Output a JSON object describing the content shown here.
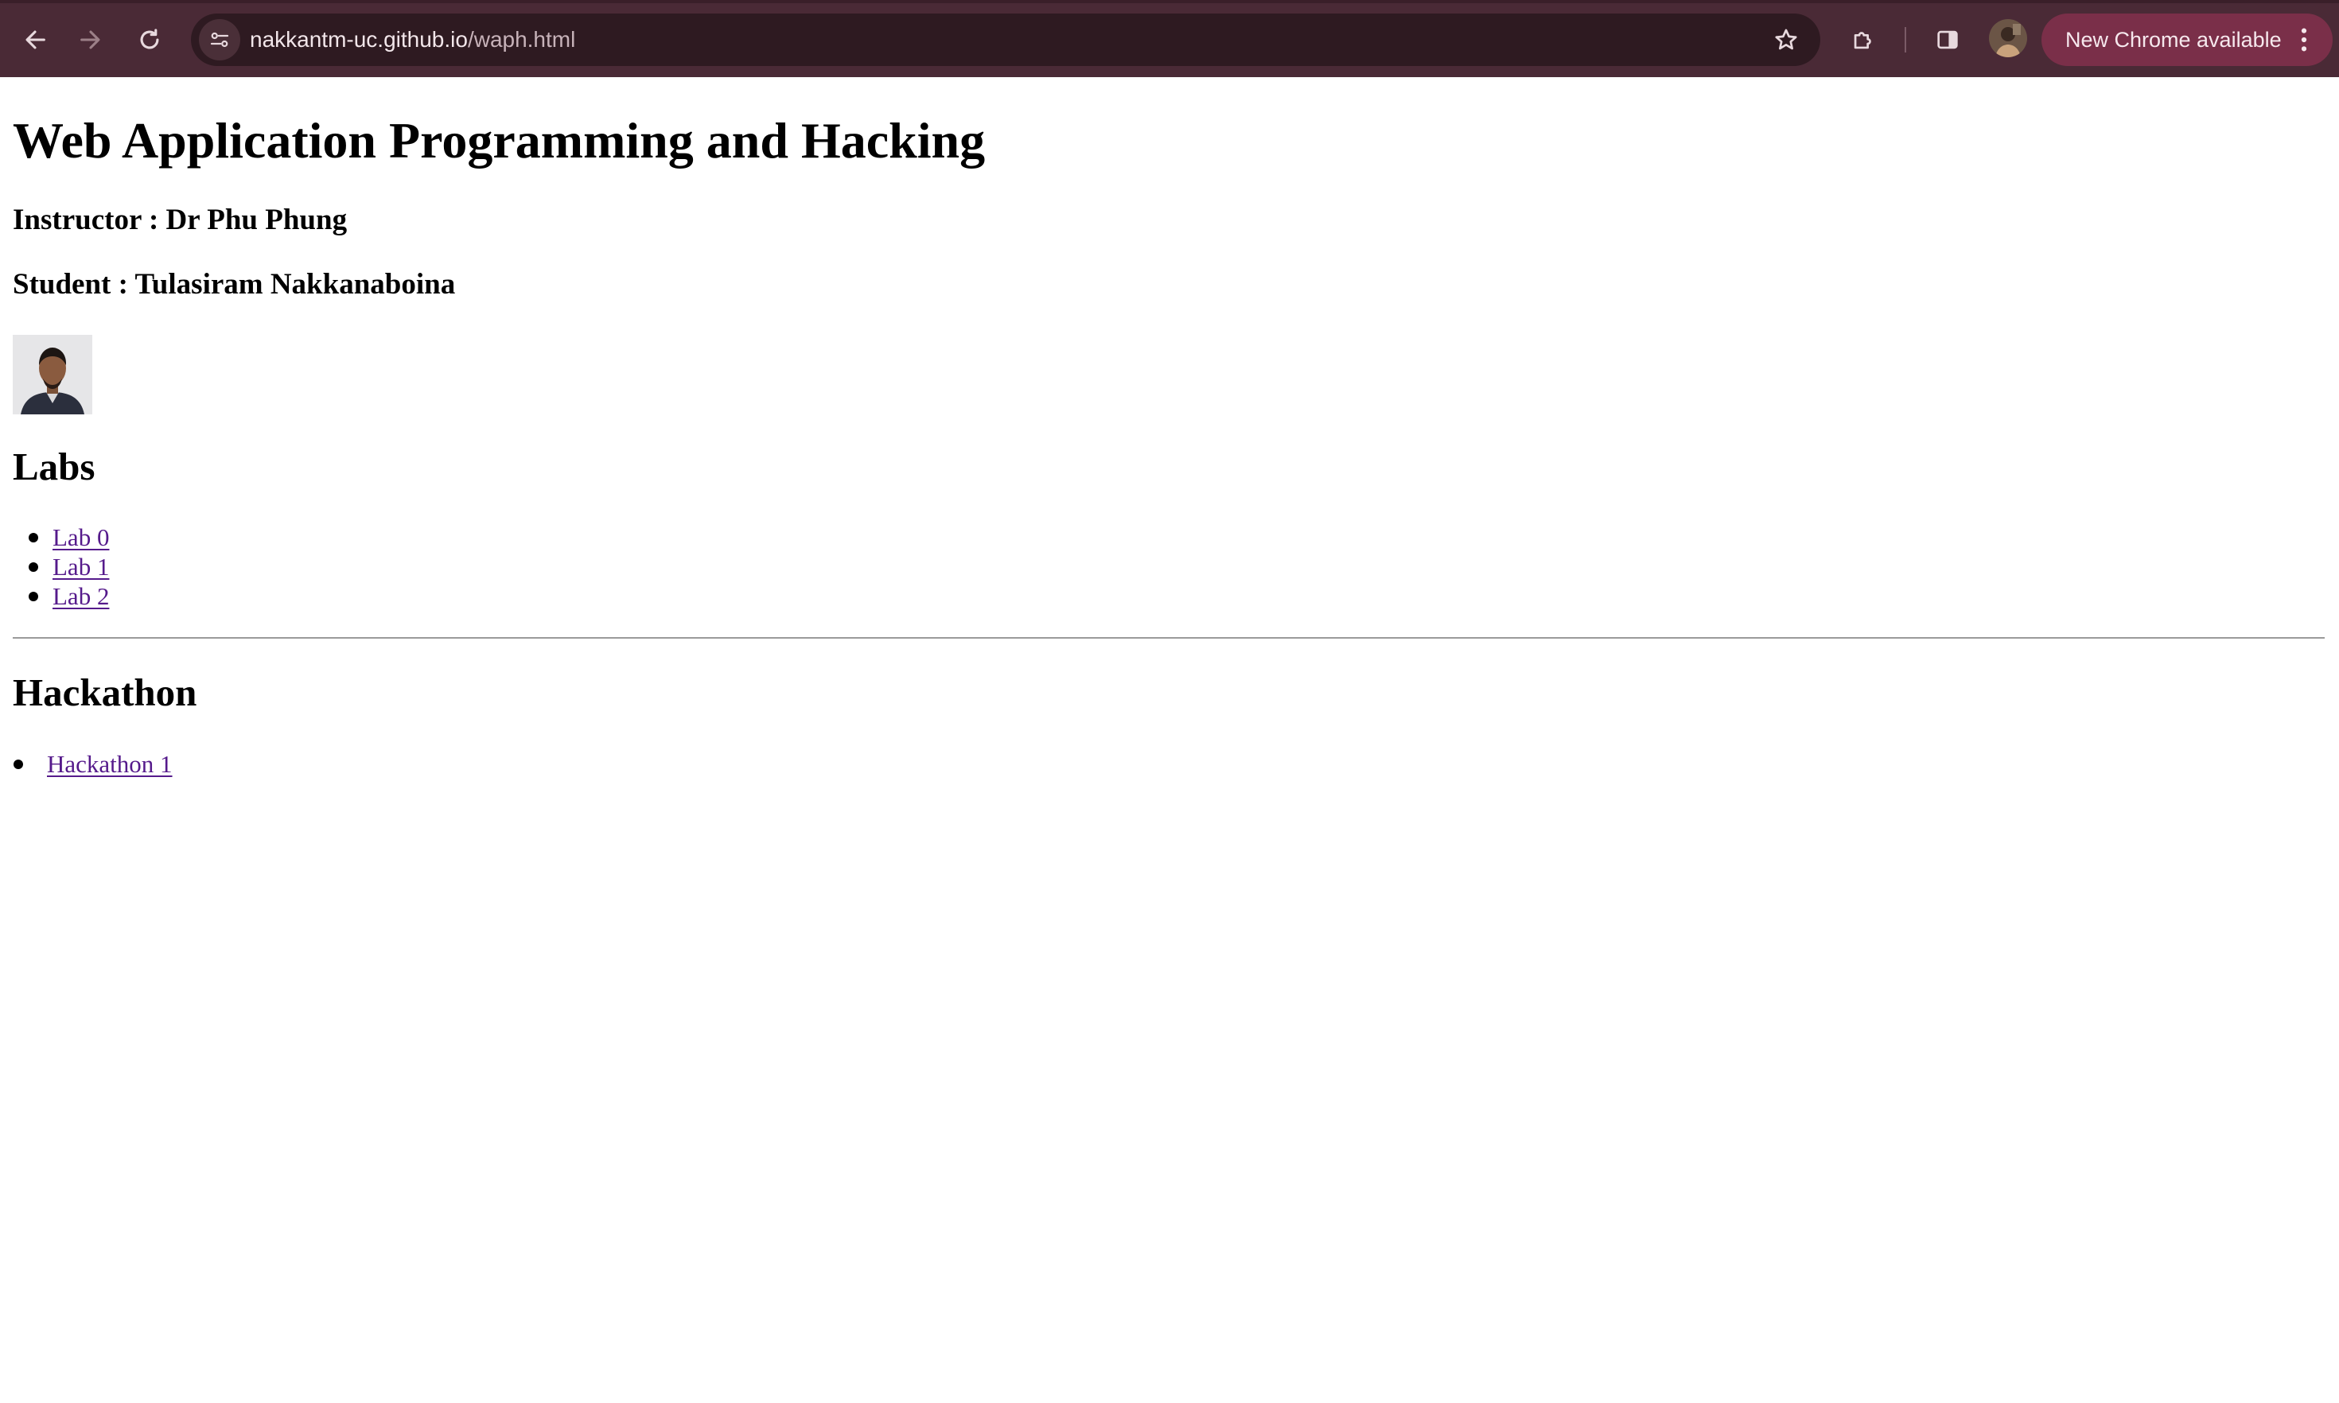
{
  "browser": {
    "url_host": "nakkantm-uc.github.io",
    "url_path": "/waph.html",
    "update_label": "New Chrome available",
    "icons": {
      "back": "arrow-left-icon",
      "forward": "arrow-right-icon",
      "reload": "reload-icon",
      "site_info": "tune-icon",
      "bookmark": "star-icon",
      "extensions": "puzzle-icon",
      "side_panel": "side-panel-icon",
      "profile": "avatar",
      "menu": "kebab-menu-icon"
    },
    "colors": {
      "toolbar": "#4a2a36",
      "omnibox": "#2e1a21",
      "update_pill": "#7a2f49"
    }
  },
  "page": {
    "title": "Web Application Programming and Hacking",
    "instructor": "Instructor : Dr Phu Phung",
    "student": "Student : Tulasiram Nakkanaboina",
    "labs_heading": "Labs",
    "labs": [
      {
        "label": "Lab 0"
      },
      {
        "label": "Lab 1"
      },
      {
        "label": "Lab 2"
      }
    ],
    "hackathon_heading": "Hackathon",
    "hackathons": [
      {
        "label": "Hackathon 1"
      }
    ],
    "link_color": "#551a8b"
  }
}
